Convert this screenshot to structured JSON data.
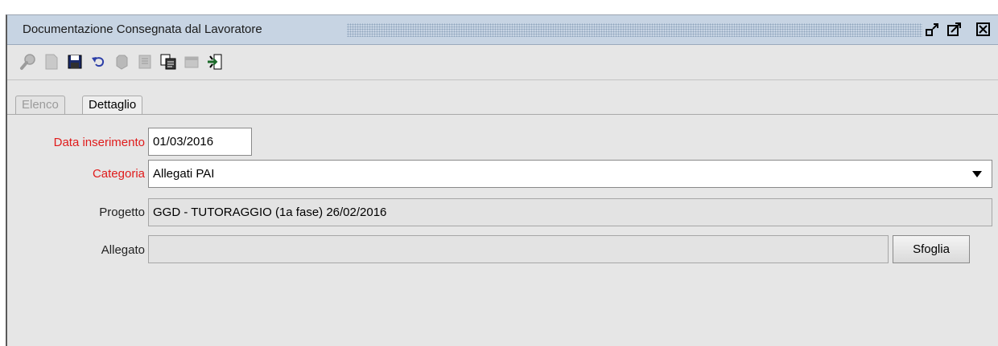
{
  "window": {
    "title": "Documentazione Consegnata dal Lavoratore",
    "controls": [
      "restore-icon",
      "maximize-icon",
      "close-icon"
    ]
  },
  "toolbar": {
    "icons": [
      "search-icon",
      "new-document-icon",
      "save-icon",
      "undo-icon",
      "delete-icon",
      "print-icon",
      "copy-icon",
      "archive-icon",
      "exit-icon"
    ]
  },
  "tabs": {
    "items": [
      "Elenco",
      "Dettaglio"
    ],
    "active": "Dettaglio"
  },
  "form": {
    "data_inserimento": {
      "label": "Data inserimento",
      "value": "01/03/2016"
    },
    "categoria": {
      "label": "Categoria",
      "value": "Allegati PAI"
    },
    "progetto": {
      "label": "Progetto",
      "value": "GGD - TUTORAGGIO (1a fase) 26/02/2016"
    },
    "allegato": {
      "label": "Allegato",
      "value": "",
      "browse_label": "Sfoglia"
    }
  },
  "colors": {
    "required_label": "#e01b1b",
    "titlebar": "#c7d4e3",
    "panel": "#e6e6e6"
  }
}
